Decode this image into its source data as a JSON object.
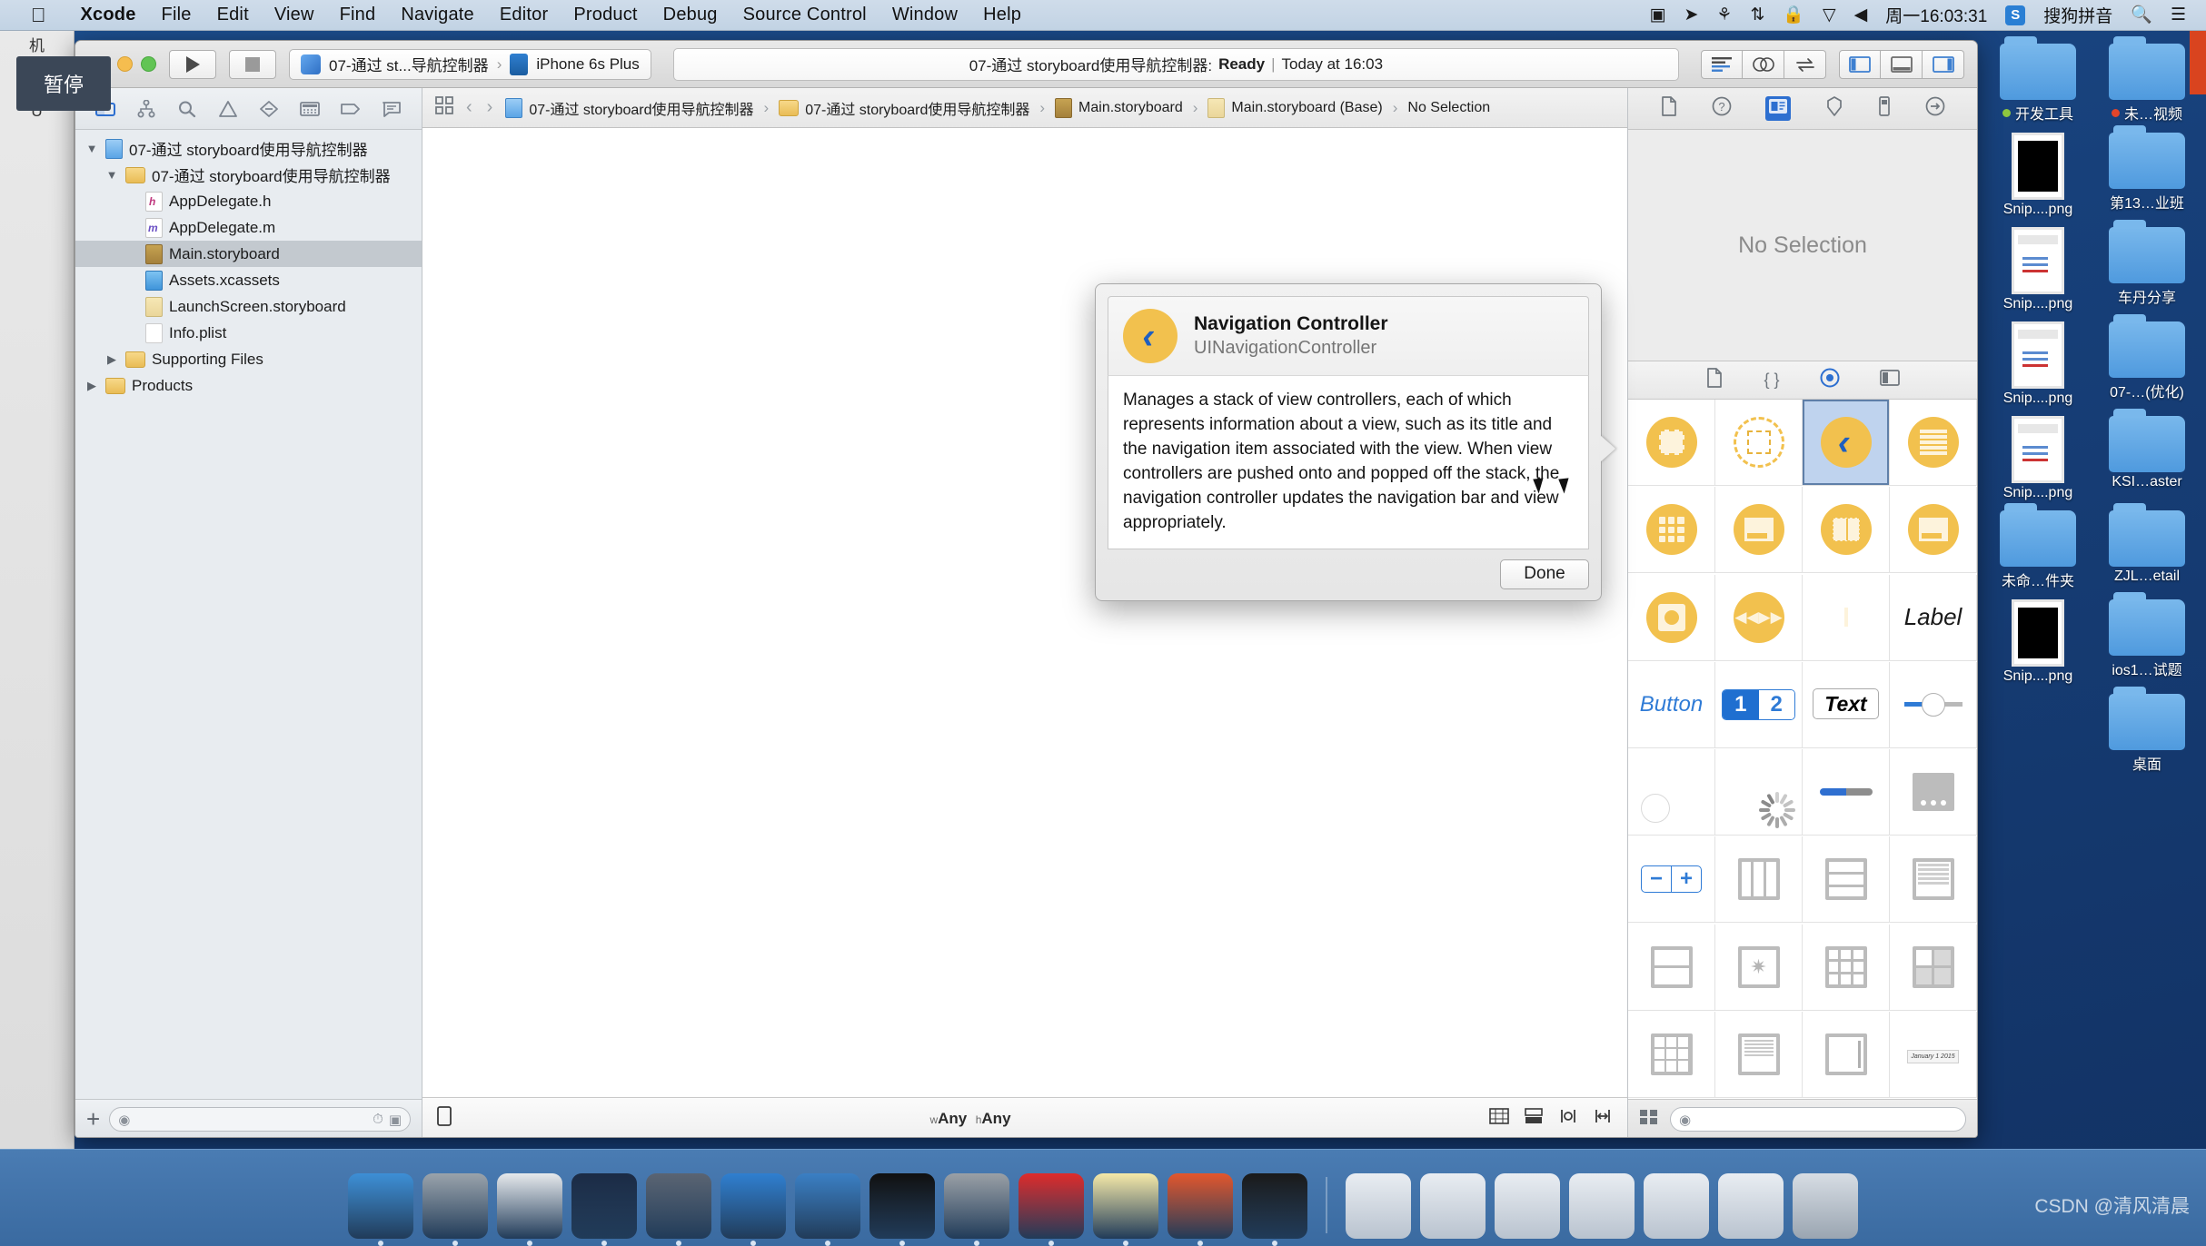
{
  "menubar": {
    "apple_icon": "apple-icon",
    "items": [
      {
        "label": "Xcode",
        "bold": true
      },
      {
        "label": "File",
        "bold": false
      },
      {
        "label": "Edit",
        "bold": false
      },
      {
        "label": "View",
        "bold": false
      },
      {
        "label": "Find",
        "bold": false
      },
      {
        "label": "Navigate",
        "bold": false
      },
      {
        "label": "Editor",
        "bold": false
      },
      {
        "label": "Product",
        "bold": false
      },
      {
        "label": "Debug",
        "bold": false
      },
      {
        "label": "Source Control",
        "bold": false
      },
      {
        "label": "Window",
        "bold": false
      },
      {
        "label": "Help",
        "bold": false
      }
    ],
    "status_icons": [
      "screen-record-icon",
      "location-icon",
      "airplay-icon",
      "bluetooth-icon",
      "lock-icon",
      "wifi-icon",
      "volume-icon"
    ],
    "clock": "周一16:03:31",
    "input_method_badge": "S",
    "input_method": "搜狗拼音",
    "search_icon": "search-icon",
    "control_center_icon": "list-icon"
  },
  "tooltip": {
    "label": "暂停"
  },
  "toolbar": {
    "run_icon": "play-icon",
    "stop_icon": "stop-icon",
    "scheme_name": "07-通过 st...导航控制器",
    "scheme_chevron": "›",
    "destination": "iPhone 6s Plus",
    "status_project": "07-通过 storyboard使用导航控制器:",
    "status_state": "Ready",
    "status_sep": "|",
    "status_time": "Today at 16:03",
    "editor_modes": [
      "standard-editor-icon",
      "assistant-editor-icon",
      "version-editor-icon"
    ],
    "panel_toggles": [
      "navigator-toggle-icon",
      "debug-area-toggle-icon",
      "utilities-toggle-icon"
    ]
  },
  "navigator": {
    "tabs": [
      "project-navigator-icon",
      "source-control-navigator-icon",
      "find-navigator-icon",
      "issue-navigator-icon",
      "test-navigator-icon",
      "debug-navigator-icon",
      "breakpoint-navigator-icon",
      "report-navigator-icon"
    ],
    "active_tab_index": 0,
    "tree": [
      {
        "label": "07-通过 storyboard使用导航控制器",
        "indent": 0,
        "twisty": "▼",
        "icon": "project-file-icon",
        "selected": false
      },
      {
        "label": "07-通过 storyboard使用导航控制器",
        "indent": 1,
        "twisty": "▼",
        "icon": "folder-icon",
        "selected": false
      },
      {
        "label": "AppDelegate.h",
        "indent": 2,
        "twisty": "",
        "icon": "header-file-icon",
        "selected": false
      },
      {
        "label": "AppDelegate.m",
        "indent": 2,
        "twisty": "",
        "icon": "objc-file-icon",
        "selected": false
      },
      {
        "label": "Main.storyboard",
        "indent": 2,
        "twisty": "",
        "icon": "storyboard-file-icon",
        "selected": true
      },
      {
        "label": "Assets.xcassets",
        "indent": 2,
        "twisty": "",
        "icon": "assets-catalog-icon",
        "selected": false
      },
      {
        "label": "LaunchScreen.storyboard",
        "indent": 2,
        "twisty": "",
        "icon": "launchscreen-file-icon",
        "selected": false
      },
      {
        "label": "Info.plist",
        "indent": 2,
        "twisty": "",
        "icon": "plist-file-icon",
        "selected": false
      },
      {
        "label": "Supporting Files",
        "indent": 1,
        "twisty": "▶",
        "icon": "folder-icon",
        "selected": false
      },
      {
        "label": "Products",
        "indent": 0,
        "twisty": "▶",
        "icon": "folder-icon",
        "selected": false
      }
    ],
    "add_button": "+",
    "filter_placeholder": "",
    "filter_value": "",
    "filter_icons": [
      "recent-icon",
      "source-control-filter-icon"
    ]
  },
  "jumpbar": {
    "related_items_icon": "related-items-icon",
    "back_icon": "‹",
    "forward_icon": "›",
    "crumbs": [
      {
        "label": "07-通过 storyboard使用导航控制器",
        "icon": "project-file-icon"
      },
      {
        "label": "07-通过 storyboard使用导航控制器",
        "icon": "folder-icon"
      },
      {
        "label": "Main.storyboard",
        "icon": "storyboard-file-icon"
      },
      {
        "label": "Main.storyboard (Base)",
        "icon": "storyboard-base-icon"
      },
      {
        "label": "No Selection",
        "icon": ""
      }
    ]
  },
  "canvas_footer": {
    "nav_bar_toggle_icon": "view-as-icon",
    "size_class_w_prefix": "w",
    "size_class_w": "Any",
    "size_class_h_prefix": "h",
    "size_class_h": "Any",
    "right_icons": [
      "zoom-icon",
      "embed-in-icon",
      "align-icon",
      "pin-icon"
    ]
  },
  "utilities": {
    "tabs": [
      "file-inspector-icon",
      "quick-help-icon",
      "identity-inspector-icon",
      "attributes-inspector-icon",
      "size-inspector-icon",
      "connections-inspector-icon"
    ],
    "active_tab_index": 2,
    "inspector_empty_text": "No Selection",
    "library_tabs": [
      "file-template-library-icon",
      "code-snippet-library-icon",
      "object-library-icon",
      "media-library-icon"
    ],
    "library_active_index": 2,
    "library_items": [
      {
        "name": "view-controller-object",
        "kind": "circle-square"
      },
      {
        "name": "storyboard-reference-object",
        "kind": "dashed-circle"
      },
      {
        "name": "navigation-controller-object",
        "kind": "chevron-back",
        "selected": true
      },
      {
        "name": "table-view-controller-object",
        "kind": "lines"
      },
      {
        "name": "collection-view-controller-object",
        "kind": "dots9"
      },
      {
        "name": "tab-bar-controller-object",
        "kind": "tabbar"
      },
      {
        "name": "split-view-controller-object",
        "kind": "book"
      },
      {
        "name": "page-view-controller-object",
        "kind": "pageview"
      },
      {
        "name": "image-view-controller-object",
        "kind": "imgview"
      },
      {
        "name": "avplayer-view-controller-object",
        "kind": "media"
      },
      {
        "name": "gl-kit-view-controller-object",
        "kind": "cube"
      },
      {
        "name": "label-object",
        "kind": "text",
        "text": "Label"
      },
      {
        "name": "button-object",
        "kind": "text-blue",
        "text": "Button"
      },
      {
        "name": "segmented-control-object",
        "kind": "segmented",
        "text_a": "1",
        "text_b": "2"
      },
      {
        "name": "text-field-object",
        "kind": "textfield",
        "text": "Text"
      },
      {
        "name": "slider-object",
        "kind": "slider"
      },
      {
        "name": "switch-object",
        "kind": "switch"
      },
      {
        "name": "activity-indicator-object",
        "kind": "spinner"
      },
      {
        "name": "progress-view-object",
        "kind": "progress"
      },
      {
        "name": "page-control-object",
        "kind": "pagecontrol"
      },
      {
        "name": "stepper-object",
        "kind": "stepper",
        "text_a": "−",
        "text_b": "+"
      },
      {
        "name": "scroll-view-object",
        "kind": "cols"
      },
      {
        "name": "table-view-object",
        "kind": "rows"
      },
      {
        "name": "table-view-cell-object",
        "kind": "rowsthin"
      },
      {
        "name": "collection-reusable-view-object",
        "kind": "rows2"
      },
      {
        "name": "image-view-object",
        "kind": "star"
      },
      {
        "name": "collection-view-object",
        "kind": "grid9"
      },
      {
        "name": "collection-view-cell-object",
        "kind": "quad"
      },
      {
        "name": "text-view-object",
        "kind": "kbd"
      },
      {
        "name": "web-view-object",
        "kind": "doc"
      },
      {
        "name": "map-kit-view-object",
        "kind": "half"
      },
      {
        "name": "date-picker-object",
        "kind": "calendar",
        "text": "January 1 2015"
      }
    ],
    "library_search_placeholder": "",
    "library_layout_icons": [
      "list-view-icon"
    ]
  },
  "popover": {
    "title": "Navigation Controller",
    "subtitle": "UINavigationController",
    "icon": "navigation-controller-icon",
    "description": "Manages a stack of view controllers, each of which represents information about a view, such as its title and the navigation item associated with the view. When view controllers are pushed onto and popped off the stack, the navigation controller updates the navigation bar and view appropriately.",
    "done_label": "Done"
  },
  "desktop": {
    "icons": [
      {
        "label": "开发工具",
        "kind": "folder",
        "dot": "green"
      },
      {
        "label": "未…视频",
        "kind": "folder",
        "dot": "red"
      },
      {
        "label": "Snip....png",
        "kind": "png-black"
      },
      {
        "label": "第13…业班",
        "kind": "folder"
      },
      {
        "label": "Snip....png",
        "kind": "png-shot"
      },
      {
        "label": "车丹分享",
        "kind": "folder"
      },
      {
        "label": "Snip....png",
        "kind": "png-shot"
      },
      {
        "label": "07-…(优化)",
        "kind": "folder"
      },
      {
        "label": "Snip....png",
        "kind": "png-shot"
      },
      {
        "label": "KSI…aster",
        "kind": "folder"
      },
      {
        "label": "未命…件夹",
        "kind": "folder"
      },
      {
        "label": "ZJL…etail",
        "kind": "folder"
      },
      {
        "label": "Snip....png",
        "kind": "png-black"
      },
      {
        "label": "ios1…试题",
        "kind": "folder"
      },
      {
        "label": "",
        "kind": "none"
      },
      {
        "label": "桌面",
        "kind": "folder"
      }
    ]
  },
  "dock": {
    "items": [
      {
        "name": "finder-icon",
        "color": "#3d8fd6"
      },
      {
        "name": "launchpad-icon",
        "color": "#9aa3ab"
      },
      {
        "name": "safari-icon",
        "color": "#e6e9ec"
      },
      {
        "name": "mouse-app-icon",
        "color": "#1b2b45"
      },
      {
        "name": "quicktime-icon",
        "color": "#5a6472"
      },
      {
        "name": "xcode-icon",
        "color": "#2f7fd0"
      },
      {
        "name": "simulator-icon",
        "color": "#3a7fc4"
      },
      {
        "name": "terminal-icon",
        "color": "#101010"
      },
      {
        "name": "system-preferences-icon",
        "color": "#9aa0a6"
      },
      {
        "name": "xmind-icon",
        "color": "#dd2b2b"
      },
      {
        "name": "notes-icon",
        "color": "#f5e9a8"
      },
      {
        "name": "dash-icon",
        "color": "#e2562c"
      },
      {
        "name": "console-icon",
        "color": "#1a1a1a"
      }
    ],
    "recent": [
      {
        "name": "recent-window-1"
      },
      {
        "name": "recent-window-2"
      },
      {
        "name": "recent-window-3"
      },
      {
        "name": "recent-window-4"
      },
      {
        "name": "recent-window-5"
      },
      {
        "name": "recent-window-6"
      }
    ],
    "trash": {
      "name": "trash-icon"
    }
  },
  "watermark": {
    "text": "CSDN @清风清晨"
  }
}
